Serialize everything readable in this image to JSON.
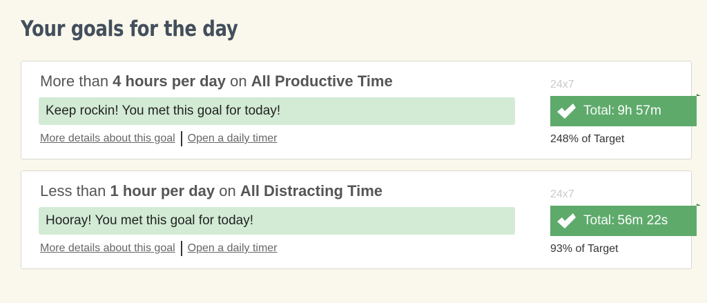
{
  "page": {
    "title": "Your goals for the day"
  },
  "goals": [
    {
      "heading_prefix": "More than ",
      "heading_amount": "4 hours per day",
      "heading_mid": " on ",
      "heading_category": "All Productive Time",
      "message": "Keep rockin! You met this goal for today!",
      "details_link": "More details about this goal",
      "timer_link": "Open a daily timer",
      "schedule": "24x7",
      "total_label": "Total:",
      "total_value": "9h 57m",
      "target_pct": "248% of Target"
    },
    {
      "heading_prefix": "Less than ",
      "heading_amount": "1 hour per day",
      "heading_mid": " on ",
      "heading_category": "All Distracting Time",
      "message": "Hooray! You met this goal for today!",
      "details_link": "More details about this goal",
      "timer_link": "Open a daily timer",
      "schedule": "24x7",
      "total_label": "Total:",
      "total_value": "56m 22s",
      "target_pct": "93% of Target"
    }
  ],
  "colors": {
    "background": "#faf8ec",
    "title": "#434f5c",
    "message_bg": "#d3ebd5",
    "badge_bg": "#5eaa6b"
  },
  "icons": {
    "badge_icon": "checkmark-icon"
  }
}
